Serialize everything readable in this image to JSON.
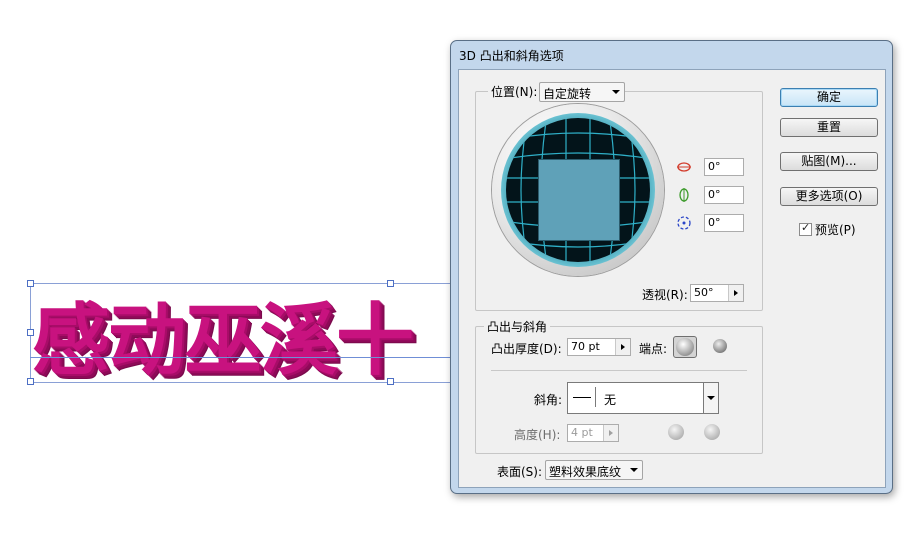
{
  "canvas": {
    "art_text": "感动巫溪十",
    "text_color": "#c8127f"
  },
  "dialog": {
    "title": "3D 凸出和斜角选项",
    "position": {
      "label": "位置(N):",
      "value": "自定旋转"
    },
    "rotation": {
      "x": "0°",
      "y": "0°",
      "z": "0°"
    },
    "perspective": {
      "label": "透视(R):",
      "value": "50°"
    },
    "extrude": {
      "group_label": "凸出与斜角",
      "depth_label": "凸出厚度(D):",
      "depth_value": "70 pt",
      "cap_label": "端点:",
      "bevel_label": "斜角:",
      "bevel_value": "无",
      "height_label": "高度(H):",
      "height_value": "4 pt"
    },
    "surface": {
      "label": "表面(S):",
      "value": "塑料效果底纹"
    },
    "buttons": {
      "ok": "确定",
      "reset": "重置",
      "map": "贴图(M)...",
      "more": "更多选项(O)"
    },
    "preview": {
      "label": "预览(P)",
      "checked": true
    }
  }
}
